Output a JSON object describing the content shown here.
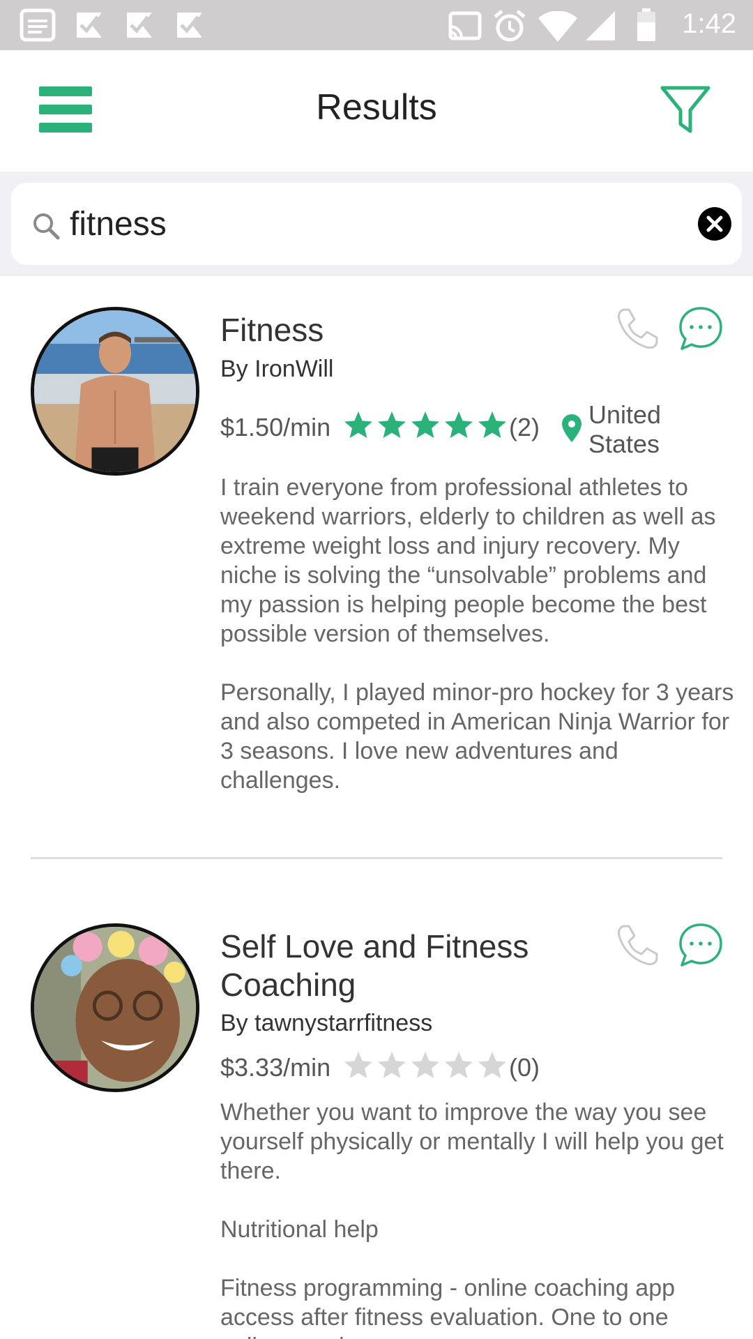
{
  "status_bar": {
    "time": "1:42"
  },
  "header": {
    "title": "Results"
  },
  "search": {
    "value": "fitness"
  },
  "colors": {
    "accent": "#2bb27a",
    "star_filled": "#2bb27a",
    "star_empty": "#d6d6d6"
  },
  "results": [
    {
      "title": "Fitness",
      "by": "By IronWill",
      "price": "$1.50/min",
      "rating_stars": 5,
      "rating_count": "(2)",
      "location": "United States",
      "description": [
        "I train everyone from professional athletes to weekend warriors, elderly to children as well as extreme weight loss and injury recovery. My niche is solving the “unsolvable” problems and my passion is helping people become the best possible version of themselves.",
        "Personally, I played minor-pro hockey for 3 years and also competed in American Ninja Warrior for 3 seasons. I love new adventures and challenges."
      ]
    },
    {
      "title": "Self Love and Fitness Coaching",
      "by": "By tawnystarrfitness",
      "price": "$3.33/min",
      "rating_stars": 0,
      "rating_count": "(0)",
      "description": [
        "Whether you want to improve the way you see yourself physically or mentally I will help you get there.",
        "Nutritional help",
        "Fitness programming - online coaching app access after fitness evaluation. One to one online sessions"
      ]
    }
  ]
}
